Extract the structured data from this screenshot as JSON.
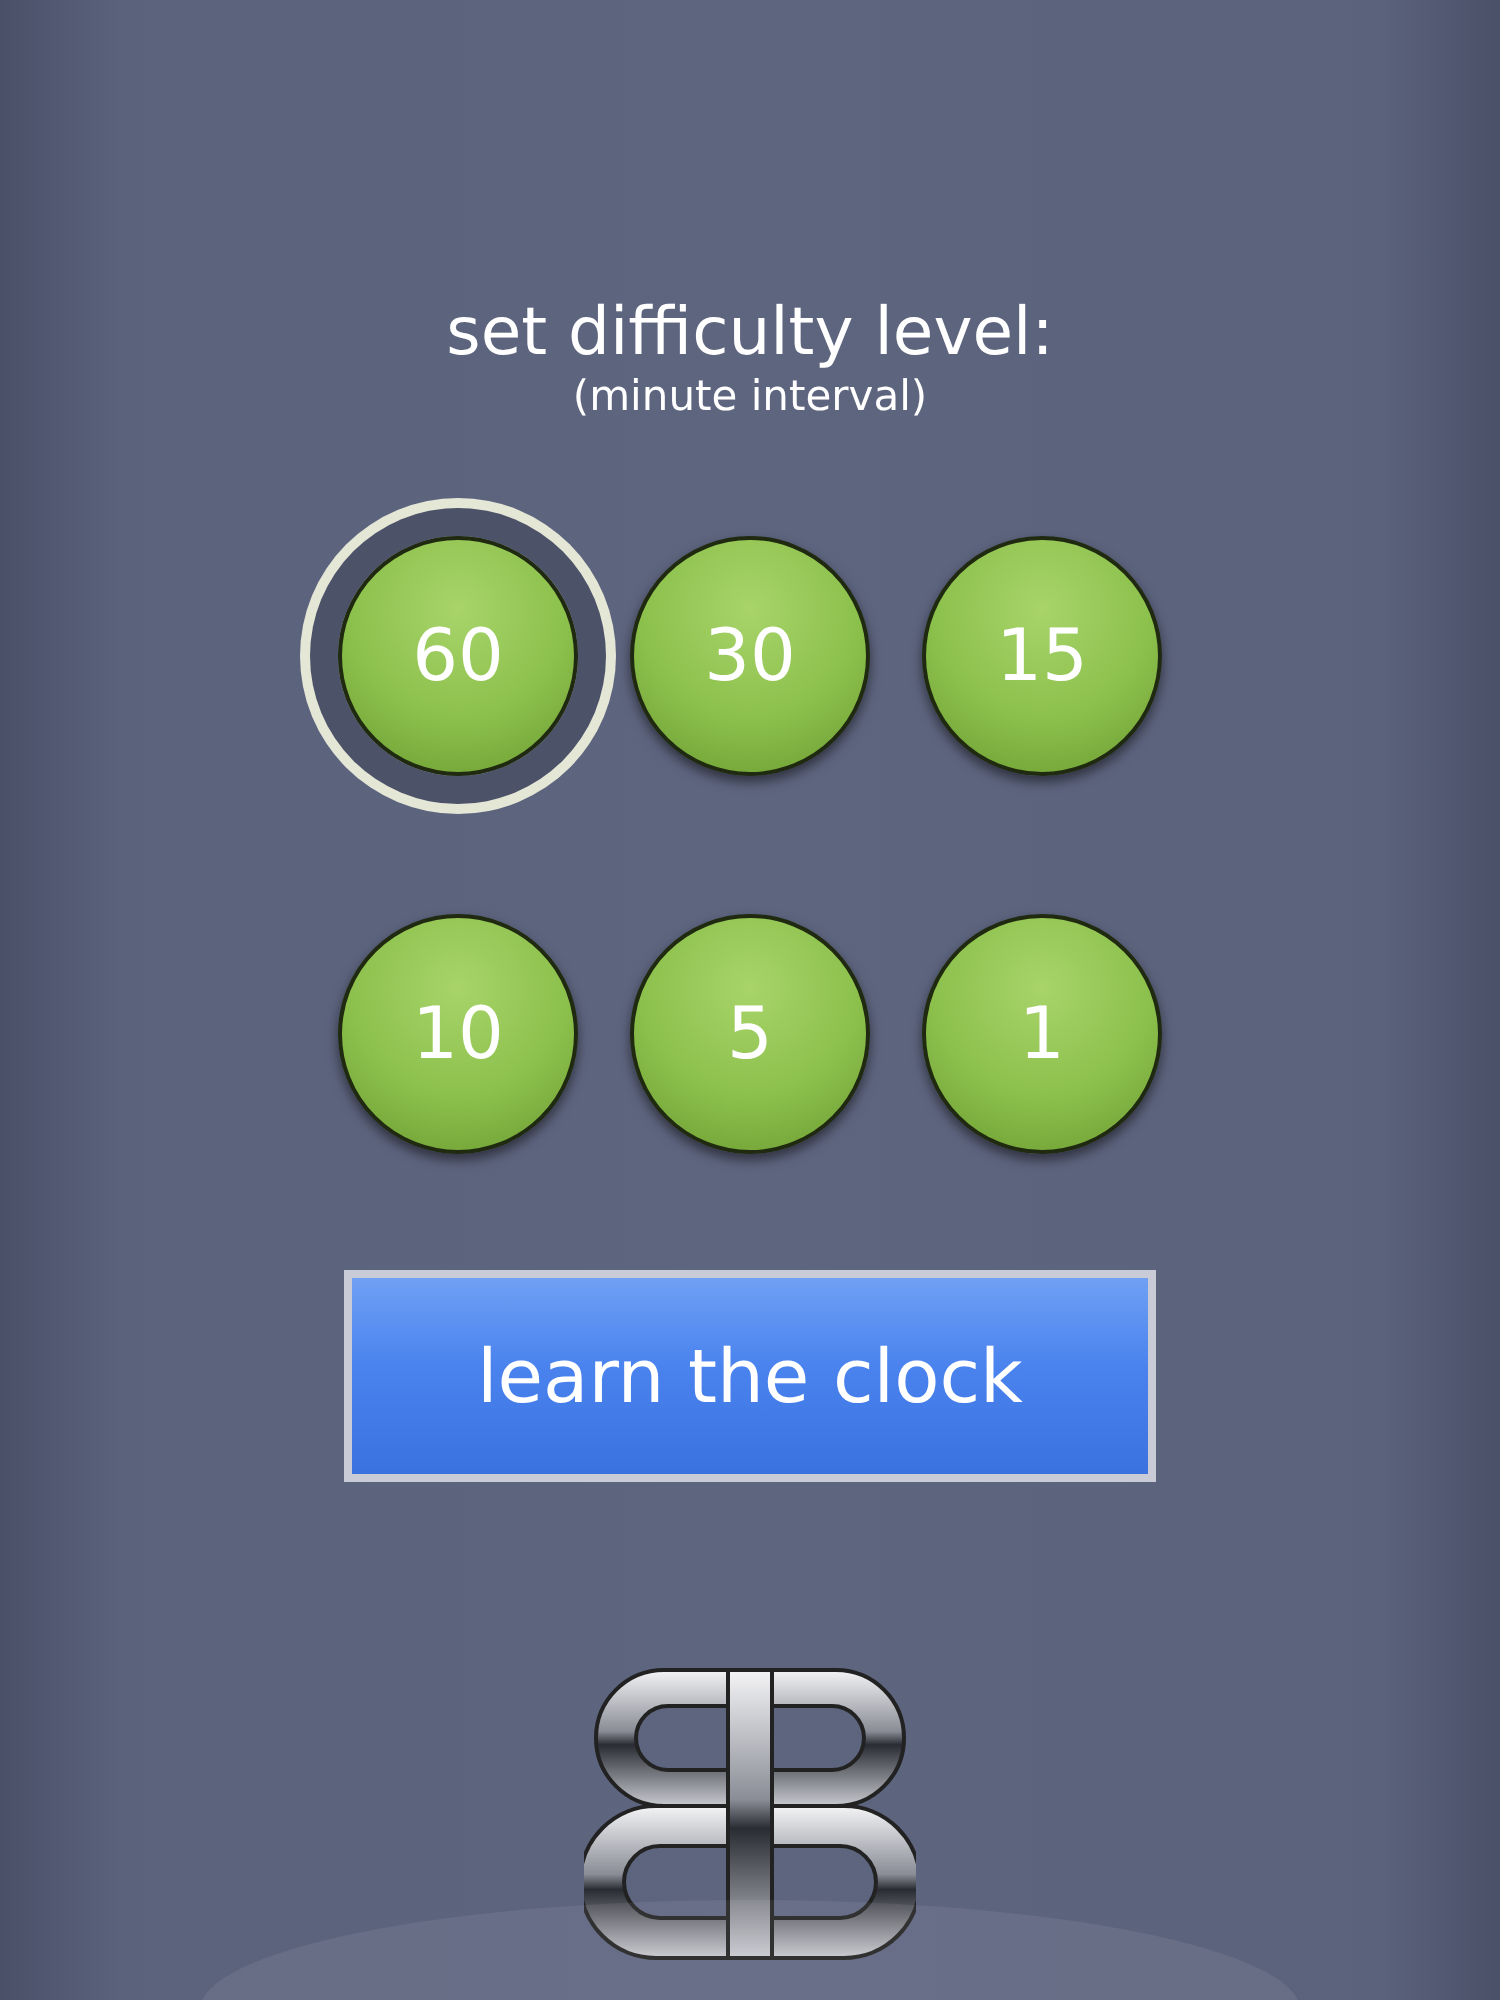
{
  "title": "set difficulty level:",
  "subtitle": "(minute interval)",
  "levels": [
    {
      "label": "60",
      "selected": true
    },
    {
      "label": "30",
      "selected": false
    },
    {
      "label": "15",
      "selected": false
    },
    {
      "label": "10",
      "selected": false
    },
    {
      "label": "5",
      "selected": false
    },
    {
      "label": "1",
      "selected": false
    }
  ],
  "action": {
    "label": "learn the clock"
  }
}
